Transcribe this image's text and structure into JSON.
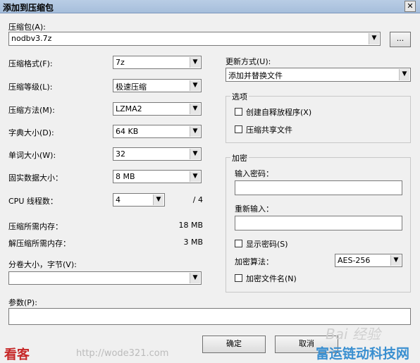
{
  "window": {
    "title": "添加到压缩包",
    "close": "✕"
  },
  "archive": {
    "label": "压缩包(A):",
    "value": "nodbv3.7z",
    "browse": "..."
  },
  "left": {
    "format": {
      "label": "压缩格式(F):",
      "value": "7z"
    },
    "level": {
      "label": "压缩等级(L):",
      "value": "极速压缩"
    },
    "method": {
      "label": "压缩方法(M):",
      "value": "LZMA2"
    },
    "dict": {
      "label": "字典大小(D):",
      "value": "64 KB"
    },
    "word": {
      "label": "单词大小(W):",
      "value": "32"
    },
    "solid": {
      "label": "固实数据大小：",
      "value": "8 MB"
    },
    "threads": {
      "label": "CPU 线程数：",
      "value": "4",
      "total": "/ 4"
    },
    "mem_compress": {
      "label": "压缩所需内存：",
      "value": "18 MB"
    },
    "mem_decompress": {
      "label": "解压缩所需内存：",
      "value": "3 MB"
    },
    "split": {
      "label": "分卷大小，字节(V):",
      "value": ""
    }
  },
  "params": {
    "label": "参数(P):",
    "value": ""
  },
  "update": {
    "label": "更新方式(U):",
    "value": "添加并替换文件"
  },
  "options": {
    "title": "选项",
    "sfx": "创建自释放程序(X)",
    "shared": "压缩共享文件"
  },
  "encryption": {
    "title": "加密",
    "password_label": "输入密码：",
    "reenter_label": "重新输入：",
    "show_password": "显示密码(S)",
    "method_label": "加密算法：",
    "method_value": "AES-256",
    "encrypt_names": "加密文件名(N)"
  },
  "buttons": {
    "ok": "确定",
    "cancel": "取消"
  },
  "watermarks": {
    "site_name": "看客",
    "site_url": "http://wode321.com",
    "baidu": "Bai 经验",
    "corner": "富运链动科技网"
  }
}
